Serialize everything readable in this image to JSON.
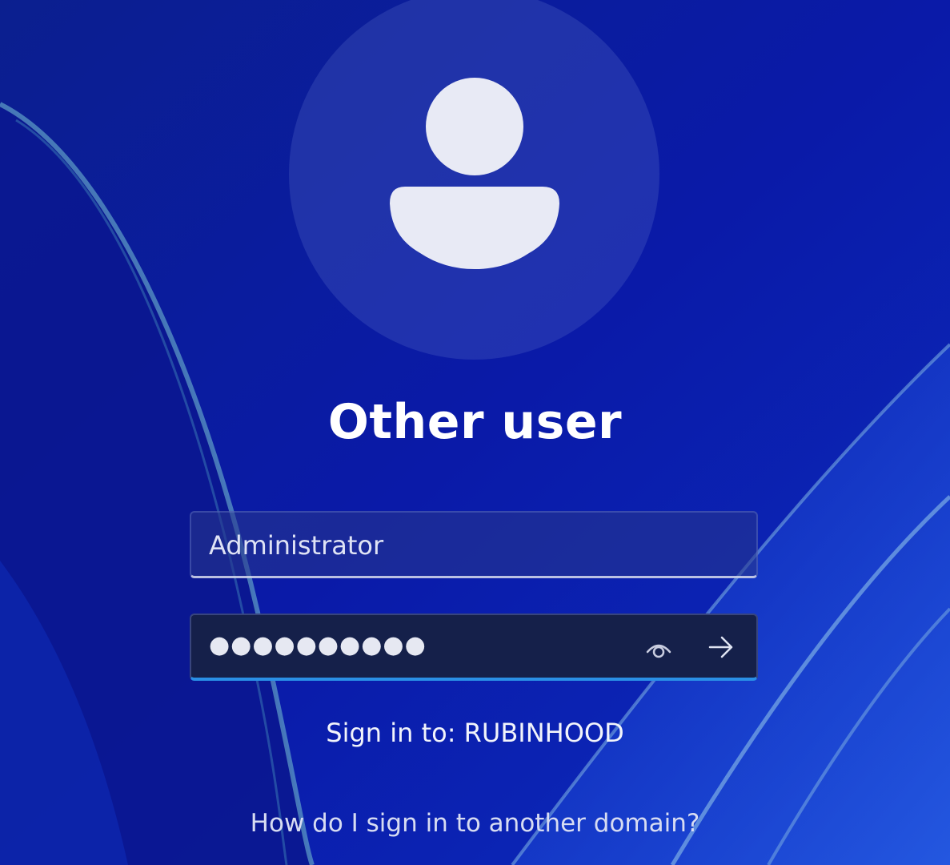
{
  "title": "Other user",
  "username": {
    "value": "Administrator"
  },
  "password": {
    "masked_value": "●●●●●●●●●●",
    "reveal_icon": "eye-icon",
    "submit_icon": "arrow-right-icon"
  },
  "sign_in_to": "Sign in to: RUBINHOOD",
  "help_link": "How do I sign in to another domain?",
  "avatar_icon": "person-icon",
  "colors": {
    "background": "#0a1a9a",
    "accent": "#2a8fe6",
    "password_field_bg": "#15204a",
    "text": "#ffffff"
  }
}
